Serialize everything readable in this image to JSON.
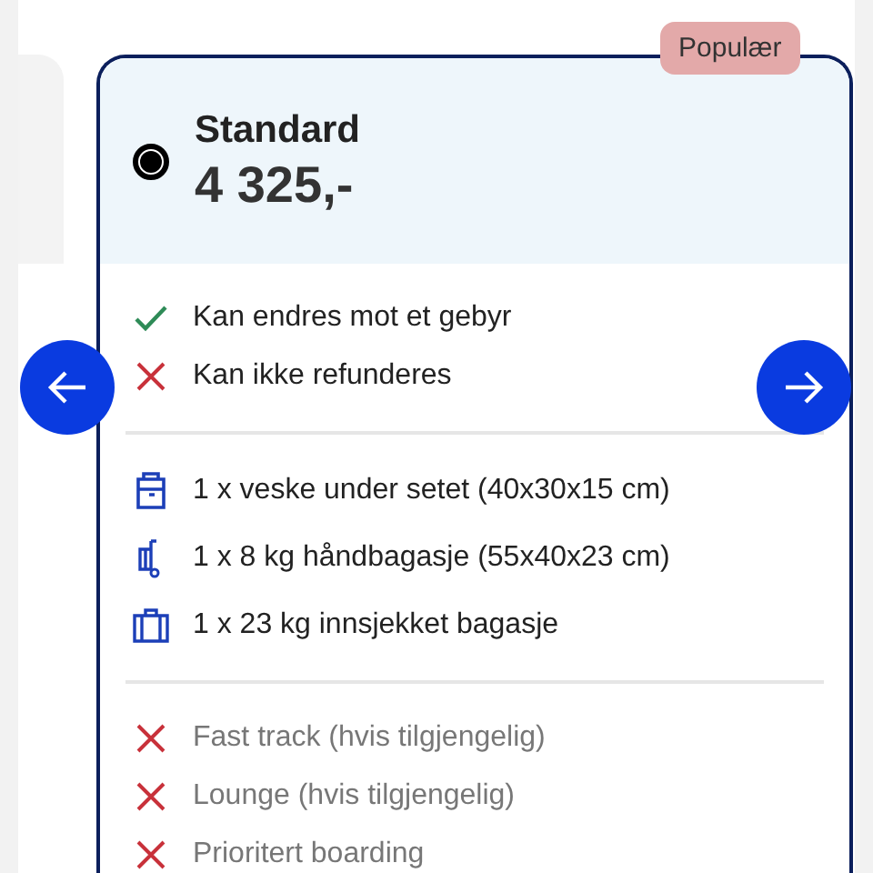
{
  "plan": {
    "badge": "Populær",
    "name": "Standard",
    "price": "4 325,-",
    "selected": true,
    "sections": [
      {
        "dimmed": false,
        "items": [
          {
            "kind": "check",
            "text": "Kan endres mot et gebyr"
          },
          {
            "kind": "cross",
            "text": "Kan ikke refunderes"
          }
        ]
      },
      {
        "dimmed": false,
        "items": [
          {
            "kind": "bag",
            "text": "1 x veske under setet (40x30x15 cm)"
          },
          {
            "kind": "trolley",
            "text": "1 x 8 kg håndbagasje (55x40x23 cm)"
          },
          {
            "kind": "suitcase",
            "text": "1 x 23 kg innsjekket bagasje"
          }
        ]
      },
      {
        "dimmed": true,
        "items": [
          {
            "kind": "cross",
            "text": "Fast track (hvis tilgjengelig)"
          },
          {
            "kind": "cross",
            "text": "Lounge (hvis tilgjengelig)"
          },
          {
            "kind": "cross",
            "text": "Prioritert boarding"
          }
        ]
      }
    ]
  }
}
